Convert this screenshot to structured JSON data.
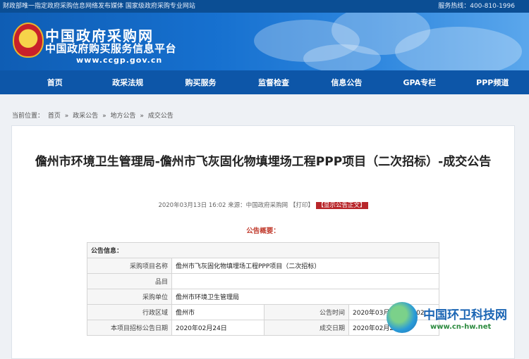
{
  "topbar": {
    "left": "财政部唯一指定政府采购信息网络发布媒体 国家级政府采购专业网站",
    "right": "服务热线：400-810-1996"
  },
  "header": {
    "title": "中国政府采购网",
    "subtitle": "中国政府购买服务信息平台",
    "url": "www.ccgp.gov.cn"
  },
  "nav": [
    "首页",
    "政采法规",
    "购买服务",
    "监督检查",
    "信息公告",
    "GPA专栏",
    "PPP频道"
  ],
  "breadcrumb": {
    "label": "当前位置：",
    "items": [
      "首页",
      "政采公告",
      "地方公告",
      "成交公告"
    ],
    "sep": "»"
  },
  "article": {
    "title": "儋州市环境卫生管理局-儋州市飞灰固化物填埋场工程PPP项目（二次招标）-成交公告",
    "date": "2020年03月13日 16:02",
    "source": "来源：中国政府采购网",
    "print": "【打印】",
    "show_text": "【显示公告正文】",
    "overview": "公告概要："
  },
  "info_table": {
    "header": "公告信息：",
    "rows": [
      {
        "label": "采购项目名称",
        "value": "儋州市飞灰固化物填埋场工程PPP项目（二次招标）"
      },
      {
        "label": "品目",
        "value": ""
      },
      {
        "label": "采购单位",
        "value": "儋州市环境卫生管理局"
      },
      {
        "label": "行政区域",
        "value": "儋州市",
        "label2": "公告时间",
        "value2": "2020年03月13日 16:02"
      },
      {
        "label": "本项目招标公告日期",
        "value": "2020年02月24日",
        "label2": "成交日期",
        "value2": "2020年02月28日"
      }
    ]
  },
  "watermark": {
    "title": "中国环卫科技网",
    "url": "www.cn-hw.net"
  }
}
